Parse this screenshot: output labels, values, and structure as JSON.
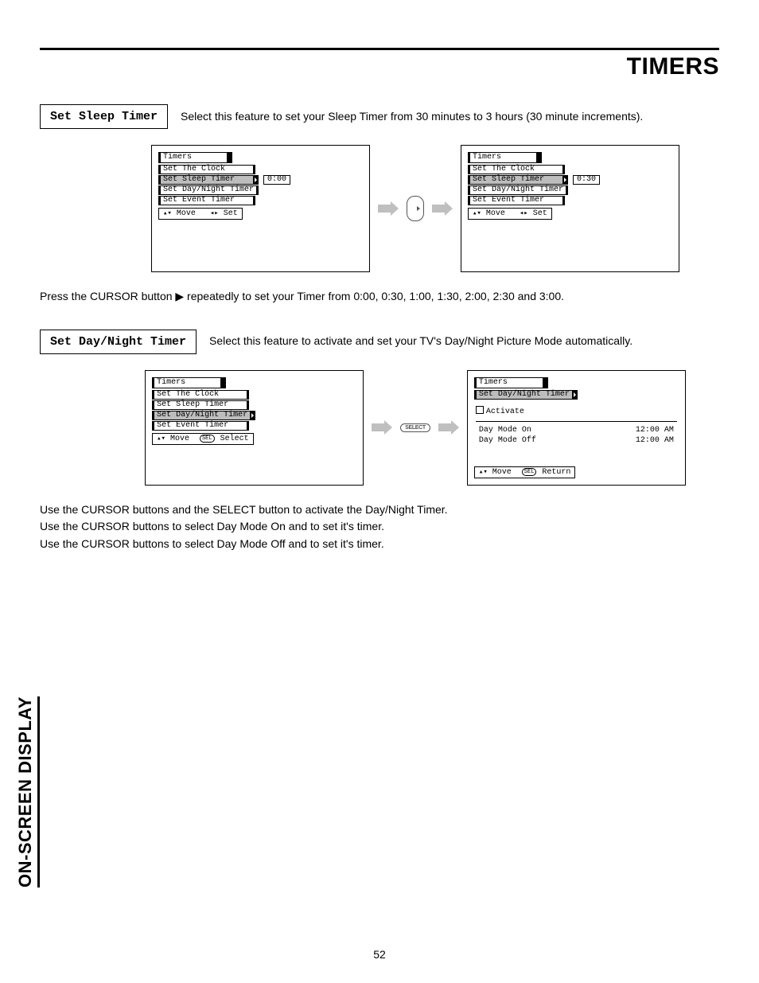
{
  "page_title": "TIMERS",
  "side_label": "ON-SCREEN DISPLAY",
  "page_number": "52",
  "section1": {
    "label": "Set Sleep Timer",
    "desc": "Select this feature to set your Sleep Timer from 30 minutes to 3 hours (30 minute increments).",
    "after_text": "Press the CURSOR button ▶ repeatedly to set your Timer from 0:00, 0:30, 1:00, 1:30, 2:00, 2:30 and 3:00."
  },
  "section2": {
    "label": "Set Day/Night Timer",
    "desc": "Select this feature to activate and set your TV's Day/Night Picture Mode automatically.",
    "after_text1": "Use the CURSOR buttons and the SELECT button to activate the Day/Night Timer.",
    "after_text2": "Use the CURSOR buttons to select Day Mode On and to set it's timer.",
    "after_text3": "Use the CURSOR buttons to select Day Mode Off and to set it's timer."
  },
  "menu": {
    "title": "Timers",
    "items": {
      "clock": "Set The Clock",
      "sleep": "Set Sleep Timer",
      "daynight": "Set Day/Night Timer",
      "event": "Set Event Timer"
    },
    "val_000": "0:00",
    "val_030": "0:30"
  },
  "hints": {
    "move_set": "Move",
    "set_lbl": "Set",
    "move": "Move",
    "select": "Select",
    "return": "Return"
  },
  "daynight_screen": {
    "title": "Timers",
    "subtitle": "Set Day/Night Timer",
    "activate": "Activate",
    "day_on": "Day Mode On",
    "day_off": "Day Mode Off",
    "time": "12:00 AM"
  },
  "remote": {
    "select_label": "SELECT"
  },
  "glyphs": {
    "updown": "▲▼",
    "leftright": "◀▶",
    "updown_small": "▴▾",
    "leftright_small": "◂▸"
  }
}
